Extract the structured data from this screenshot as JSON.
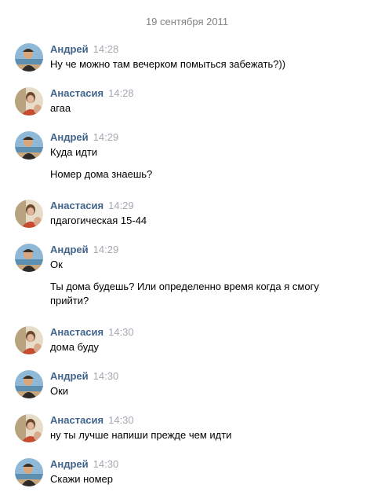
{
  "date_separator": "19 сентября 2011",
  "messages": [
    {
      "author": "Андрей",
      "time": "14:28",
      "avatar": "andrey-avatar",
      "texts": [
        "Ну че можно там вечерком помыться забежать?))"
      ]
    },
    {
      "author": "Анастасия",
      "time": "14:28",
      "avatar": "anastasia-avatar",
      "texts": [
        "агаа"
      ]
    },
    {
      "author": "Андрей",
      "time": "14:29",
      "avatar": "andrey-avatar",
      "texts": [
        "Куда идти",
        "Номер дома знаешь?"
      ]
    },
    {
      "author": "Анастасия",
      "time": "14:29",
      "avatar": "anastasia-avatar",
      "texts": [
        "пдагогическая 15-44"
      ]
    },
    {
      "author": "Андрей",
      "time": "14:29",
      "avatar": "andrey-avatar",
      "texts": [
        "Ок",
        "Ты дома будешь? Или определенно время когда я смогу прийти?"
      ]
    },
    {
      "author": "Анастасия",
      "time": "14:30",
      "avatar": "anastasia-avatar",
      "texts": [
        "дома буду"
      ]
    },
    {
      "author": "Андрей",
      "time": "14:30",
      "avatar": "andrey-avatar",
      "texts": [
        "Оки"
      ]
    },
    {
      "author": "Анастасия",
      "time": "14:30",
      "avatar": "anastasia-avatar",
      "texts": [
        "ну ты лучше напиши прежде чем идти"
      ]
    },
    {
      "author": "Андрей",
      "time": "14:30",
      "avatar": "andrey-avatar",
      "texts": [
        "Скажи номер"
      ]
    }
  ],
  "colors": {
    "author": "#42648b",
    "time": "#a4a8b0",
    "date": "#828282",
    "text": "#000000"
  }
}
